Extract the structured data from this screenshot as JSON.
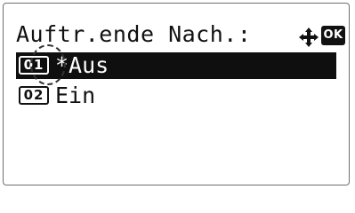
{
  "screen": {
    "title": "Auftr.ende Nach.:",
    "nav_icon": "four-way-arrow-icon",
    "ok_label": "OK"
  },
  "options": [
    {
      "number": "01",
      "label": "*Aus",
      "selected": true
    },
    {
      "number": "02",
      "label": " Ein",
      "selected": false
    }
  ],
  "colors": {
    "text": "#111111",
    "highlight_bg": "#0f0f0f",
    "highlight_text": "#ffffff",
    "border": "#6f6f6f"
  }
}
